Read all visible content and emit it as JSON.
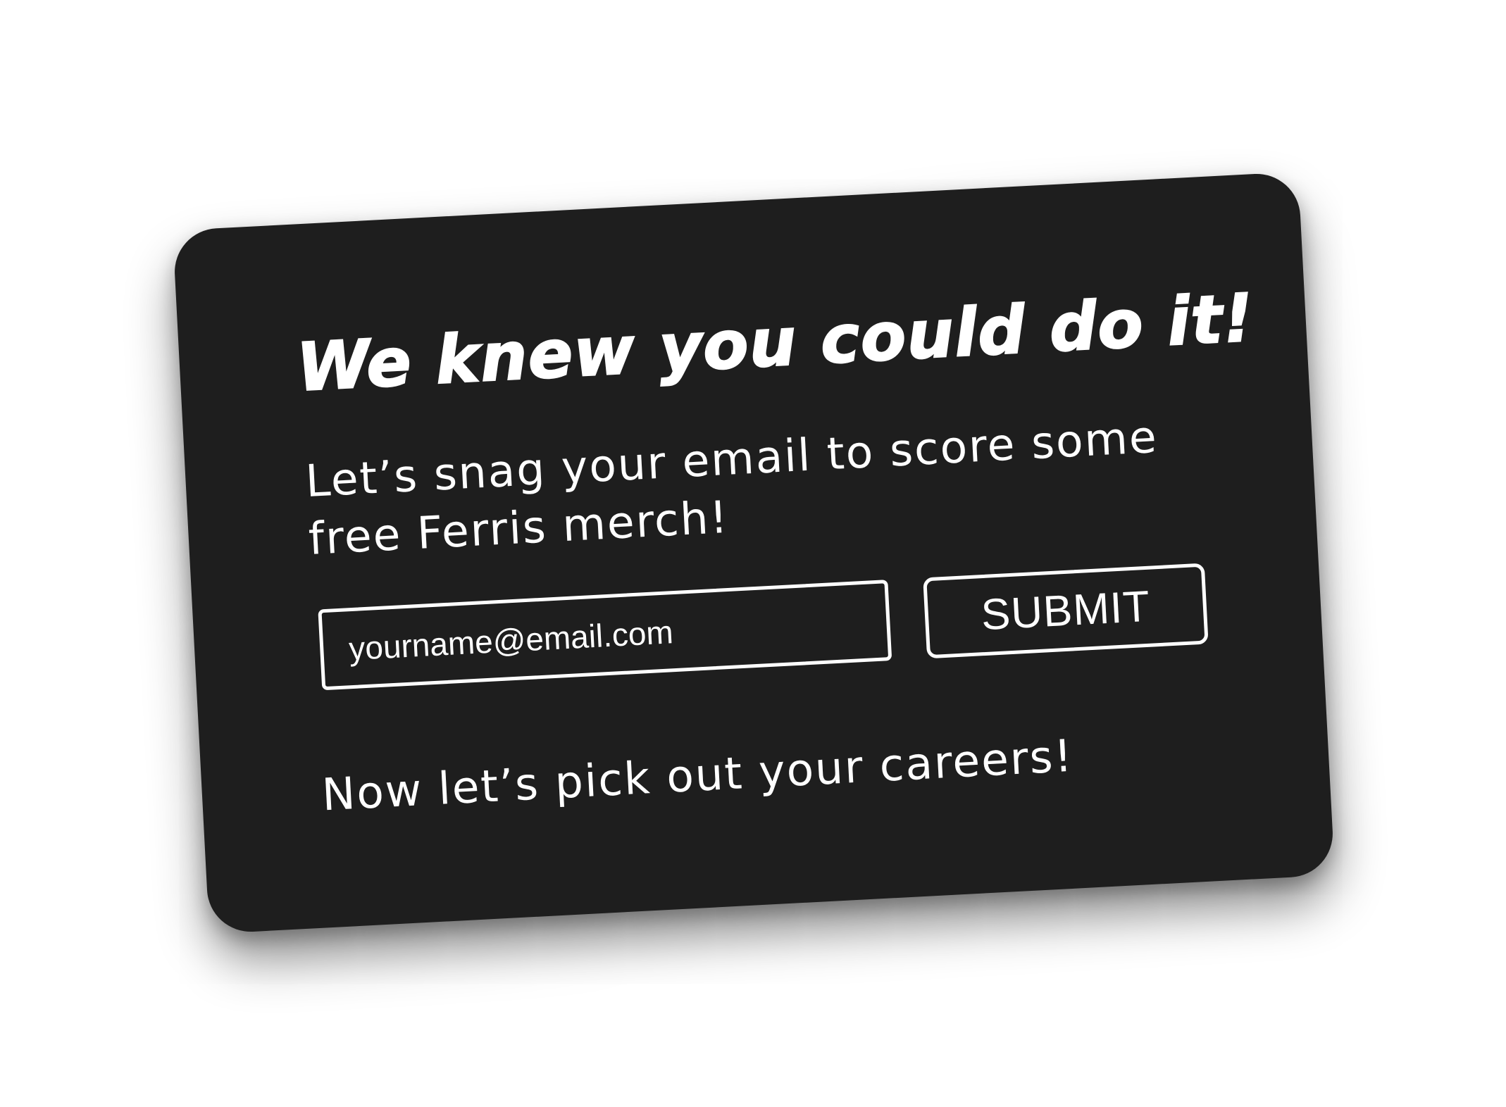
{
  "card": {
    "headline": "We knew you could do it!",
    "subtext": "Let’s snag your email to score some free Ferris merch!",
    "email": {
      "placeholder": "yourname@email.com",
      "value": ""
    },
    "submit_label": "SUBMIT",
    "footer_text": "Now let’s pick out your careers!"
  },
  "colors": {
    "card_background": "#1e1e1e",
    "text": "#ffffff",
    "page_background": "#ffffff"
  }
}
